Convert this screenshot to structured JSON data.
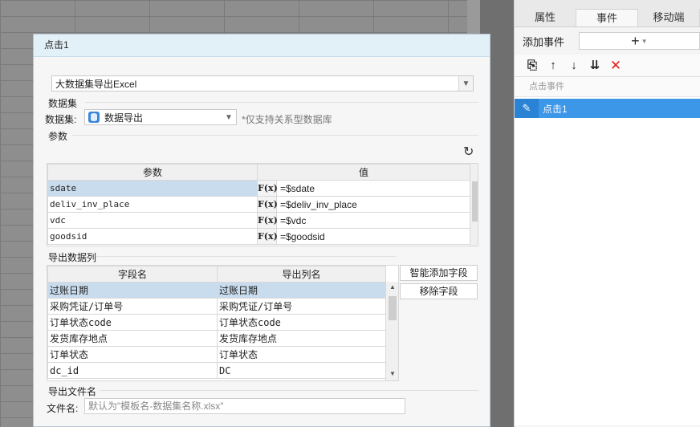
{
  "right_panel": {
    "tabs": [
      "属性",
      "事件",
      "移动端"
    ],
    "active_tab": 1,
    "add_event_label": "添加事件",
    "event_header": "点击事件",
    "events": [
      "点击1"
    ]
  },
  "dialog": {
    "title": "点击1",
    "action_select": "大数据集导出Excel",
    "dataset_section": "数据集",
    "dataset_label": "数据集:",
    "dataset_value": "数据导出",
    "dataset_hint": "*仅支持关系型数据库",
    "params_section": "参数",
    "params_table": {
      "headers": [
        "参数",
        "值"
      ],
      "rows": [
        {
          "name": "sdate",
          "value": "=$sdate"
        },
        {
          "name": "deliv_inv_place",
          "value": "=$deliv_inv_place"
        },
        {
          "name": "vdc",
          "value": "=$vdc"
        },
        {
          "name": "goodsid",
          "value": "=$goodsid"
        }
      ],
      "fx_label": "F(x)"
    },
    "export_section": "导出数据列",
    "fields_table": {
      "headers": [
        "字段名",
        "导出列名"
      ],
      "rows": [
        {
          "field": "过账日期",
          "column": "过账日期"
        },
        {
          "field": "采购凭证/订单号",
          "column": "采购凭证/订单号"
        },
        {
          "field": "订单状态code",
          "column": "订单状态code"
        },
        {
          "field": "发货库存地点",
          "column": "发货库存地点"
        },
        {
          "field": "订单状态",
          "column": "订单状态"
        },
        {
          "field": "dc_id",
          "column": "DC"
        }
      ]
    },
    "smart_add_button": "智能添加字段",
    "remove_button": "移除字段",
    "filename_section": "导出文件名",
    "filename_label": "文件名:",
    "filename_placeholder": "默认为\"模板名-数据集名称.xlsx\""
  }
}
